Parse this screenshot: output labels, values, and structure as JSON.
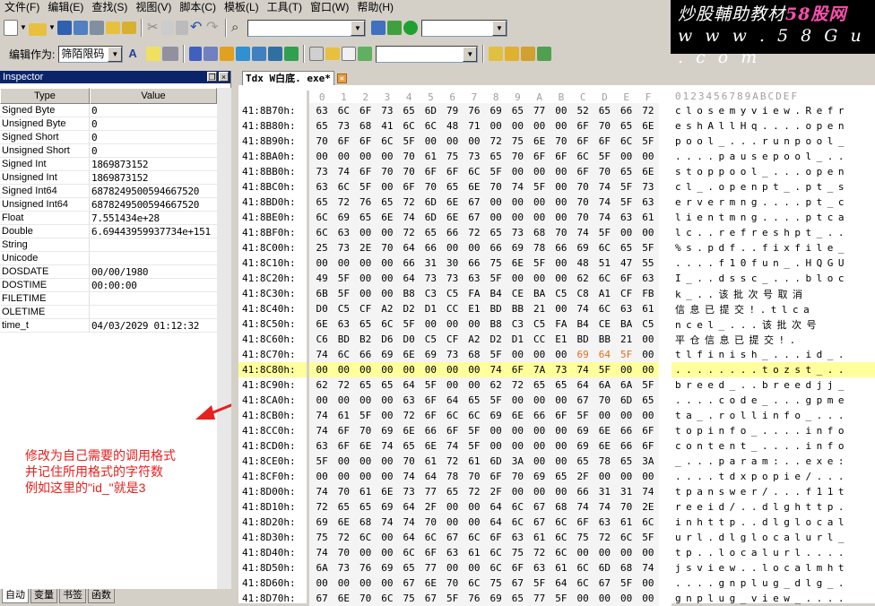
{
  "menu": [
    "文件(F)",
    "编辑(E)",
    "查找(S)",
    "视图(V)",
    "脚本(C)",
    "模板(L)",
    "工具(T)",
    "窗口(W)",
    "帮助(H)"
  ],
  "watermark": {
    "line1_prefix": "炒股輔助教材",
    "line1_brand": "58股网",
    "line2": "w w w . 5 8 G u . c o m"
  },
  "toolbar2": {
    "edit_as_label": "编辑作为:",
    "edit_as_value": "筛陌限码"
  },
  "inspector": {
    "title": "Inspector",
    "col_type": "Type",
    "col_value": "Value",
    "rows": [
      {
        "type": "Signed Byte",
        "value": "0"
      },
      {
        "type": "Unsigned Byte",
        "value": "0"
      },
      {
        "type": "Signed Short",
        "value": "0"
      },
      {
        "type": "Unsigned Short",
        "value": "0"
      },
      {
        "type": "Signed Int",
        "value": "1869873152"
      },
      {
        "type": "Unsigned Int",
        "value": "1869873152"
      },
      {
        "type": "Signed Int64",
        "value": "6878249500594667520"
      },
      {
        "type": "Unsigned Int64",
        "value": "6878249500594667520"
      },
      {
        "type": "Float",
        "value": "7.551434e+28"
      },
      {
        "type": "Double",
        "value": "6.69443959937734e+151"
      },
      {
        "type": "String",
        "value": ""
      },
      {
        "type": "Unicode",
        "value": ""
      },
      {
        "type": "DOSDATE",
        "value": "00/00/1980"
      },
      {
        "type": "DOSTIME",
        "value": "00:00:00"
      },
      {
        "type": "FILETIME",
        "value": ""
      },
      {
        "type": "OLETIME",
        "value": ""
      },
      {
        "type": "time_t",
        "value": "04/03/2029 01:12:32"
      }
    ]
  },
  "annotation": [
    "修改为自己需要的调用格式",
    "并记住所用格式的字符数",
    "例如这里的\"id_\"就是3"
  ],
  "bottom_tabs": [
    "自动",
    "变量",
    "书签",
    "函数"
  ],
  "document": {
    "tab": "Tdx W白底. exe*"
  },
  "hex": {
    "header_cols": [
      "0",
      "1",
      "2",
      "3",
      "4",
      "5",
      "6",
      "7",
      "8",
      "9",
      "A",
      "B",
      "C",
      "D",
      "E",
      "F"
    ],
    "header_ascii": "0123456789ABCDEF",
    "rows": [
      {
        "off": "41:8B70h:",
        "bytes": [
          "63",
          "6C",
          "6F",
          "73",
          "65",
          "6D",
          "79",
          "76",
          "69",
          "65",
          "77",
          "00",
          "52",
          "65",
          "66",
          "72"
        ],
        "ascii": "closemyview.Refr"
      },
      {
        "off": "41:8B80h:",
        "bytes": [
          "65",
          "73",
          "68",
          "41",
          "6C",
          "6C",
          "48",
          "71",
          "00",
          "00",
          "00",
          "00",
          "6F",
          "70",
          "65",
          "6E"
        ],
        "ascii": "eshAllHq....open"
      },
      {
        "off": "41:8B90h:",
        "bytes": [
          "70",
          "6F",
          "6F",
          "6C",
          "5F",
          "00",
          "00",
          "00",
          "72",
          "75",
          "6E",
          "70",
          "6F",
          "6F",
          "6C",
          "5F"
        ],
        "ascii": "pool_...runpool_"
      },
      {
        "off": "41:8BA0h:",
        "bytes": [
          "00",
          "00",
          "00",
          "00",
          "70",
          "61",
          "75",
          "73",
          "65",
          "70",
          "6F",
          "6F",
          "6C",
          "5F",
          "00",
          "00"
        ],
        "ascii": "....pausepool_.."
      },
      {
        "off": "41:8BB0h:",
        "bytes": [
          "73",
          "74",
          "6F",
          "70",
          "70",
          "6F",
          "6F",
          "6C",
          "5F",
          "00",
          "00",
          "00",
          "6F",
          "70",
          "65",
          "6E"
        ],
        "ascii": "stoppool_...open"
      },
      {
        "off": "41:8BC0h:",
        "bytes": [
          "63",
          "6C",
          "5F",
          "00",
          "6F",
          "70",
          "65",
          "6E",
          "70",
          "74",
          "5F",
          "00",
          "70",
          "74",
          "5F",
          "73"
        ],
        "ascii": "cl_.openpt_.pt_s"
      },
      {
        "off": "41:8BD0h:",
        "bytes": [
          "65",
          "72",
          "76",
          "65",
          "72",
          "6D",
          "6E",
          "67",
          "00",
          "00",
          "00",
          "00",
          "70",
          "74",
          "5F",
          "63"
        ],
        "ascii": "ervermng....pt_c"
      },
      {
        "off": "41:8BE0h:",
        "bytes": [
          "6C",
          "69",
          "65",
          "6E",
          "74",
          "6D",
          "6E",
          "67",
          "00",
          "00",
          "00",
          "00",
          "70",
          "74",
          "63",
          "61"
        ],
        "ascii": "lientmng....ptca"
      },
      {
        "off": "41:8BF0h:",
        "bytes": [
          "6C",
          "63",
          "00",
          "00",
          "72",
          "65",
          "66",
          "72",
          "65",
          "73",
          "68",
          "70",
          "74",
          "5F",
          "00",
          "00"
        ],
        "ascii": "lc..refreshpt_.."
      },
      {
        "off": "41:8C00h:",
        "bytes": [
          "25",
          "73",
          "2E",
          "70",
          "64",
          "66",
          "00",
          "00",
          "66",
          "69",
          "78",
          "66",
          "69",
          "6C",
          "65",
          "5F"
        ],
        "ascii": "%s.pdf..fixfile_"
      },
      {
        "off": "41:8C10h:",
        "bytes": [
          "00",
          "00",
          "00",
          "00",
          "66",
          "31",
          "30",
          "66",
          "75",
          "6E",
          "5F",
          "00",
          "48",
          "51",
          "47",
          "55"
        ],
        "ascii": "....f10fun_.HQGU"
      },
      {
        "off": "41:8C20h:",
        "bytes": [
          "49",
          "5F",
          "00",
          "00",
          "64",
          "73",
          "73",
          "63",
          "5F",
          "00",
          "00",
          "00",
          "62",
          "6C",
          "6F",
          "63"
        ],
        "ascii": "I_..dssc_...bloc"
      },
      {
        "off": "41:8C30h:",
        "bytes": [
          "6B",
          "5F",
          "00",
          "00",
          "B8",
          "C3",
          "C5",
          "FA",
          "B4",
          "CE",
          "BA",
          "C5",
          "C8",
          "A1",
          "CF",
          "FB"
        ],
        "ascii": "k_..该批次号取消"
      },
      {
        "off": "41:8C40h:",
        "bytes": [
          "D0",
          "C5",
          "CF",
          "A2",
          "D2",
          "D1",
          "CC",
          "E1",
          "BD",
          "BB",
          "21",
          "00",
          "74",
          "6C",
          "63",
          "61"
        ],
        "ascii": "信息已提交!.tlca"
      },
      {
        "off": "41:8C50h:",
        "bytes": [
          "6E",
          "63",
          "65",
          "6C",
          "5F",
          "00",
          "00",
          "00",
          "B8",
          "C3",
          "C5",
          "FA",
          "B4",
          "CE",
          "BA",
          "C5"
        ],
        "ascii": "ncel_...该批次号"
      },
      {
        "off": "41:8C60h:",
        "bytes": [
          "C6",
          "BD",
          "B2",
          "D6",
          "D0",
          "C5",
          "CF",
          "A2",
          "D2",
          "D1",
          "CC",
          "E1",
          "BD",
          "BB",
          "21",
          "00"
        ],
        "ascii": "平仓信息已提交!."
      },
      {
        "off": "41:8C70h:",
        "bytes": [
          "74",
          "6C",
          "66",
          "69",
          "6E",
          "69",
          "73",
          "68",
          "5F",
          "00",
          "00",
          "00",
          "69",
          "64",
          "5F",
          "00"
        ],
        "ascii": "tlfinish_...id_.",
        "color_cols": [
          12,
          13,
          14
        ]
      },
      {
        "off": "41:8C80h:",
        "bytes": [
          "00",
          "00",
          "00",
          "00",
          "00",
          "00",
          "00",
          "00",
          "74",
          "6F",
          "7A",
          "73",
          "74",
          "5F",
          "00",
          "00"
        ],
        "ascii": "........tozst_..",
        "highlight": true
      },
      {
        "off": "41:8C90h:",
        "bytes": [
          "62",
          "72",
          "65",
          "65",
          "64",
          "5F",
          "00",
          "00",
          "62",
          "72",
          "65",
          "65",
          "64",
          "6A",
          "6A",
          "5F"
        ],
        "ascii": "breed_..breedjj_"
      },
      {
        "off": "41:8CA0h:",
        "bytes": [
          "00",
          "00",
          "00",
          "00",
          "63",
          "6F",
          "64",
          "65",
          "5F",
          "00",
          "00",
          "00",
          "67",
          "70",
          "6D",
          "65"
        ],
        "ascii": "....code_...gpme"
      },
      {
        "off": "41:8CB0h:",
        "bytes": [
          "74",
          "61",
          "5F",
          "00",
          "72",
          "6F",
          "6C",
          "6C",
          "69",
          "6E",
          "66",
          "6F",
          "5F",
          "00",
          "00",
          "00"
        ],
        "ascii": "ta_.rollinfo_..."
      },
      {
        "off": "41:8CC0h:",
        "bytes": [
          "74",
          "6F",
          "70",
          "69",
          "6E",
          "66",
          "6F",
          "5F",
          "00",
          "00",
          "00",
          "00",
          "69",
          "6E",
          "66",
          "6F"
        ],
        "ascii": "topinfo_....info"
      },
      {
        "off": "41:8CD0h:",
        "bytes": [
          "63",
          "6F",
          "6E",
          "74",
          "65",
          "6E",
          "74",
          "5F",
          "00",
          "00",
          "00",
          "00",
          "69",
          "6E",
          "66",
          "6F"
        ],
        "ascii": "content_....info"
      },
      {
        "off": "41:8CE0h:",
        "bytes": [
          "5F",
          "00",
          "00",
          "00",
          "70",
          "61",
          "72",
          "61",
          "6D",
          "3A",
          "00",
          "00",
          "65",
          "78",
          "65",
          "3A"
        ],
        "ascii": "_...param:..exe:"
      },
      {
        "off": "41:8CF0h:",
        "bytes": [
          "00",
          "00",
          "00",
          "00",
          "74",
          "64",
          "78",
          "70",
          "6F",
          "70",
          "69",
          "65",
          "2F",
          "00",
          "00",
          "00"
        ],
        "ascii": "....tdxpopie/..."
      },
      {
        "off": "41:8D00h:",
        "bytes": [
          "74",
          "70",
          "61",
          "6E",
          "73",
          "77",
          "65",
          "72",
          "2F",
          "00",
          "00",
          "00",
          "66",
          "31",
          "31",
          "74"
        ],
        "ascii": "tpanswer/...f11t"
      },
      {
        "off": "41:8D10h:",
        "bytes": [
          "72",
          "65",
          "65",
          "69",
          "64",
          "2F",
          "00",
          "00",
          "64",
          "6C",
          "67",
          "68",
          "74",
          "74",
          "70",
          "2E"
        ],
        "ascii": "reeid/..dlghttp."
      },
      {
        "off": "41:8D20h:",
        "bytes": [
          "69",
          "6E",
          "68",
          "74",
          "74",
          "70",
          "00",
          "00",
          "64",
          "6C",
          "67",
          "6C",
          "6F",
          "63",
          "61",
          "6C"
        ],
        "ascii": "inhttp..dlglocal"
      },
      {
        "off": "41:8D30h:",
        "bytes": [
          "75",
          "72",
          "6C",
          "00",
          "64",
          "6C",
          "67",
          "6C",
          "6F",
          "63",
          "61",
          "6C",
          "75",
          "72",
          "6C",
          "5F"
        ],
        "ascii": "url.dlglocalurl_"
      },
      {
        "off": "41:8D40h:",
        "bytes": [
          "74",
          "70",
          "00",
          "00",
          "6C",
          "6F",
          "63",
          "61",
          "6C",
          "75",
          "72",
          "6C",
          "00",
          "00",
          "00",
          "00"
        ],
        "ascii": "tp..localurl...."
      },
      {
        "off": "41:8D50h:",
        "bytes": [
          "6A",
          "73",
          "76",
          "69",
          "65",
          "77",
          "00",
          "00",
          "6C",
          "6F",
          "63",
          "61",
          "6C",
          "6D",
          "68",
          "74"
        ],
        "ascii": "jsview..localmht"
      },
      {
        "off": "41:8D60h:",
        "bytes": [
          "00",
          "00",
          "00",
          "00",
          "67",
          "6E",
          "70",
          "6C",
          "75",
          "67",
          "5F",
          "64",
          "6C",
          "67",
          "5F",
          "00"
        ],
        "ascii": "....gnplug_dlg_."
      },
      {
        "off": "41:8D70h:",
        "bytes": [
          "67",
          "6E",
          "70",
          "6C",
          "75",
          "67",
          "5F",
          "76",
          "69",
          "65",
          "77",
          "5F",
          "00",
          "00",
          "00",
          "00"
        ],
        "ascii": "gnplug_view_...."
      }
    ]
  }
}
